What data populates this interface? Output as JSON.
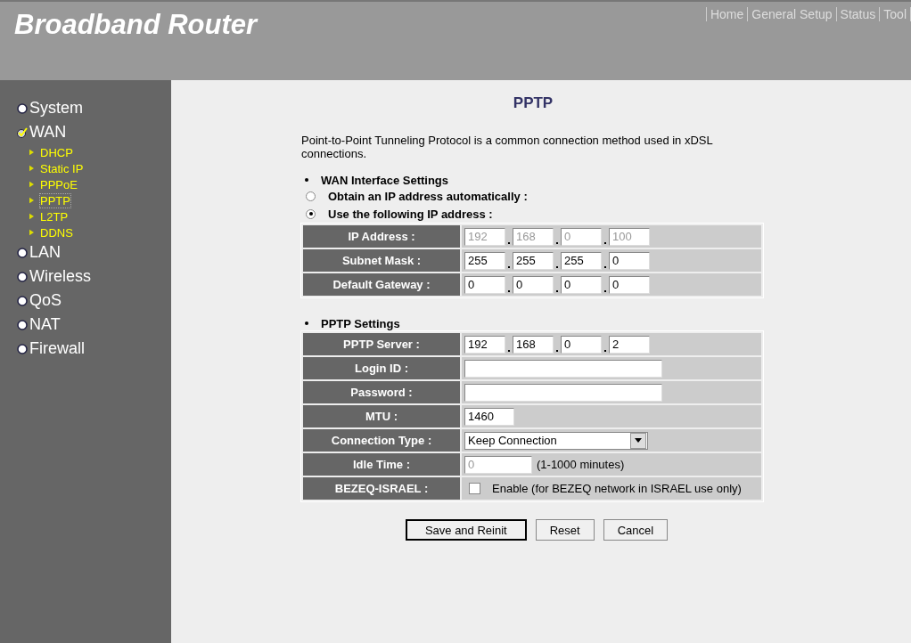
{
  "header": {
    "title": "Broadband Router",
    "nav": [
      "Home",
      "General Setup",
      "Status",
      "Tool"
    ]
  },
  "sidebar": {
    "items": [
      {
        "label": "System",
        "expanded": false
      },
      {
        "label": "WAN",
        "expanded": true,
        "children": [
          {
            "label": "DHCP",
            "selected": false
          },
          {
            "label": "Static IP",
            "selected": false
          },
          {
            "label": "PPPoE",
            "selected": false
          },
          {
            "label": "PPTP",
            "selected": true
          },
          {
            "label": "L2TP",
            "selected": false
          },
          {
            "label": "DDNS",
            "selected": false
          }
        ]
      },
      {
        "label": "LAN",
        "expanded": false
      },
      {
        "label": "Wireless",
        "expanded": false
      },
      {
        "label": "QoS",
        "expanded": false
      },
      {
        "label": "NAT",
        "expanded": false
      },
      {
        "label": "Firewall",
        "expanded": false
      }
    ]
  },
  "page": {
    "title": "PPTP",
    "description": "Point-to-Point Tunneling Protocol is a common connection method used in xDSL connections."
  },
  "wan_section": {
    "heading": "WAN Interface Settings",
    "options": [
      {
        "label": "Obtain an IP address automatically :",
        "selected": false
      },
      {
        "label": "Use the following IP address :",
        "selected": true
      }
    ],
    "rows": [
      {
        "kind": "ip",
        "label": "IP Address :",
        "values": [
          "192",
          "168",
          "0",
          "100"
        ],
        "disabled": true
      },
      {
        "kind": "ip",
        "label": "Subnet Mask :",
        "values": [
          "255",
          "255",
          "255",
          "0"
        ],
        "disabled": false
      },
      {
        "kind": "ip",
        "label": "Default Gateway :",
        "values": [
          "0",
          "0",
          "0",
          "0"
        ],
        "disabled": false
      }
    ]
  },
  "pptp_section": {
    "heading": "PPTP Settings",
    "rows": [
      {
        "kind": "ip",
        "label": "PPTP Server :",
        "values": [
          "192",
          "168",
          "0",
          "2"
        ],
        "disabled": false
      },
      {
        "kind": "text",
        "label": "Login ID :"
      },
      {
        "kind": "text",
        "label": "Password :"
      },
      {
        "kind": "text",
        "label": "MTU :",
        "value": "1460"
      },
      {
        "kind": "select",
        "label": "Connection Type :",
        "value": "Keep Connection"
      },
      {
        "kind": "idle",
        "label": "Idle Time :",
        "value": "0",
        "note": "(1-1000 minutes)",
        "disabled": true
      },
      {
        "kind": "checkbox",
        "label": "BEZEQ-ISRAEL :",
        "text": "Enable (for BEZEQ network in ISRAEL use only)",
        "checked": false
      }
    ]
  },
  "buttons": [
    {
      "label": "Save and Reinit",
      "default": true
    },
    {
      "label": "Reset",
      "default": false
    },
    {
      "label": "Cancel",
      "default": false
    }
  ]
}
